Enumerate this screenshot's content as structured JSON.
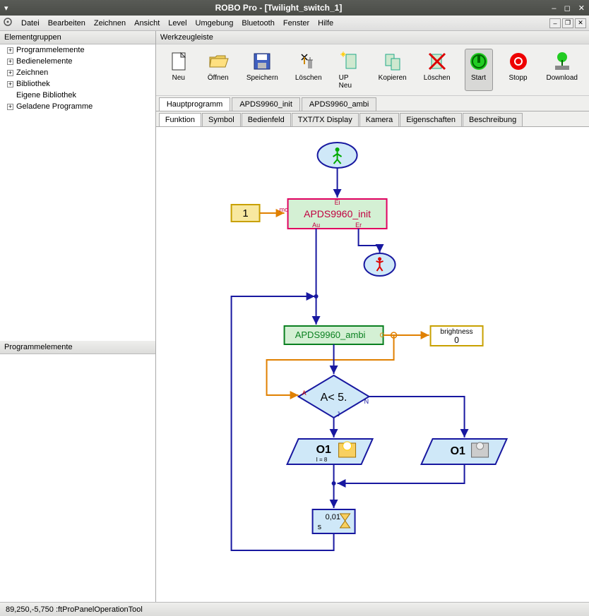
{
  "titlebar": {
    "title": "ROBO Pro - [Twilight_switch_1]"
  },
  "menu": {
    "items": [
      "Datei",
      "Bearbeiten",
      "Zeichnen",
      "Ansicht",
      "Level",
      "Umgebung",
      "Bluetooth",
      "Fenster",
      "Hilfe"
    ]
  },
  "sidebar": {
    "header": "Elementgruppen",
    "tree": [
      {
        "label": "Programmelemente",
        "expandable": true
      },
      {
        "label": "Bedienelemente",
        "expandable": true
      },
      {
        "label": "Zeichnen",
        "expandable": true
      },
      {
        "label": "Bibliothek",
        "expandable": true
      },
      {
        "label": "Eigene Bibliothek",
        "expandable": false
      },
      {
        "label": "Geladene Programme",
        "expandable": true
      }
    ],
    "panel2": "Programmelemente"
  },
  "toolbar": {
    "label": "Werkzeugleiste",
    "buttons": [
      {
        "name": "new",
        "label": "Neu"
      },
      {
        "name": "open",
        "label": "Öffnen"
      },
      {
        "name": "save",
        "label": "Speichern"
      },
      {
        "name": "delete",
        "label": "Löschen"
      },
      {
        "name": "upnew",
        "label": "UP Neu"
      },
      {
        "name": "copy",
        "label": "Kopieren"
      },
      {
        "name": "delete2",
        "label": "Löschen"
      },
      {
        "name": "start",
        "label": "Start",
        "active": true
      },
      {
        "name": "stop",
        "label": "Stopp"
      },
      {
        "name": "download",
        "label": "Download"
      }
    ]
  },
  "fileTabs": [
    {
      "label": "Hauptprogramm",
      "active": true
    },
    {
      "label": "APDS9960_init"
    },
    {
      "label": "APDS9960_ambi"
    }
  ],
  "viewTabs": [
    {
      "label": "Funktion",
      "active": true
    },
    {
      "label": "Symbol"
    },
    {
      "label": "Bedienfeld"
    },
    {
      "label": "TXT/TX Display"
    },
    {
      "label": "Kamera"
    },
    {
      "label": "Eigenschaften"
    },
    {
      "label": "Beschreibung"
    }
  ],
  "flowchart": {
    "const1": "1",
    "const1_out": "mo",
    "block1": {
      "label": "APDS9960_init",
      "top": "Ei",
      "bottomL": "Au",
      "bottomR": "Er"
    },
    "block2": {
      "label": "APDS9960_ambi",
      "right": "C"
    },
    "varBox": {
      "label": "brightness",
      "value": "0"
    },
    "decision": {
      "label": "A< 5.",
      "left": "A",
      "right": "N",
      "bottom": "J"
    },
    "out1": {
      "label": "O1",
      "sub": "I = 8"
    },
    "out2": {
      "label": "O1"
    },
    "delay": {
      "value": "0,01",
      "unit": "s"
    }
  },
  "status": "89,250,-5,750 :ftProPanelOperationTool"
}
